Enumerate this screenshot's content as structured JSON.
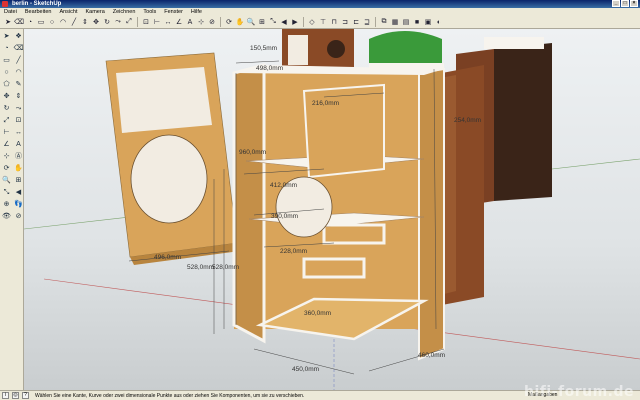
{
  "window": {
    "title": "berlin - SketchUp",
    "min": "_",
    "max": "□",
    "close": "×"
  },
  "menu": [
    "Datei",
    "Bearbeiten",
    "Ansicht",
    "Kamera",
    "Zeichnen",
    "Tools",
    "Fenster",
    "Hilfe"
  ],
  "toolbar_icons": [
    "select-icon",
    "eraser-icon",
    "paint-icon",
    "rectangle-icon",
    "circle-icon",
    "arc-icon",
    "line-icon",
    "pushpull-icon",
    "move-icon",
    "rotate-icon",
    "followme-icon",
    "scale-icon",
    "offset-icon",
    "tape-icon",
    "dimension-icon",
    "protractor-icon",
    "text-icon",
    "axes-icon",
    "section-icon",
    "orbit-icon",
    "pan-icon",
    "zoom-icon",
    "zoom-window-icon",
    "zoom-extents-icon",
    "previous-view-icon",
    "next-view-icon",
    "iso-view-icon",
    "top-view-icon",
    "front-view-icon",
    "right-view-icon",
    "back-view-icon",
    "left-view-icon",
    "xray-icon",
    "wireframe-icon",
    "hidden-line-icon",
    "shaded-icon",
    "textured-icon",
    "monochrome-icon"
  ],
  "left_tools": [
    "select",
    "component",
    "paint",
    "eraser",
    "rectangle",
    "line",
    "circle",
    "arc",
    "polygon",
    "freehand",
    "move",
    "pushpull",
    "rotate",
    "followme",
    "scale",
    "offset",
    "tape",
    "dimension",
    "protractor",
    "text",
    "axes",
    "3dtext",
    "orbit",
    "pan",
    "zoom",
    "zoom-window",
    "zoom-extents",
    "previous",
    "position-camera",
    "walk",
    "look-around",
    "section"
  ],
  "dimensions": {
    "d1": "150,5mm",
    "d2": "498,0mm",
    "d3": "216,0mm",
    "d4": "254,0mm",
    "d5": "960,0mm",
    "d6": "412,0mm",
    "d7": "390,0mm",
    "d8": "228,0mm",
    "d9": "496,0mm",
    "d10": "528,0mm",
    "d11": "528,0mm",
    "d12": "360,0mm",
    "d13": "450,0mm",
    "d14": "460,0mm"
  },
  "status": {
    "message": "Wählen Sie eine Kante, Kurve oder zwei dimensionale Punkte aus oder ziehen Sie Komponenten, um sie zu verschieben.",
    "measure_label": "Maßangaben"
  },
  "watermark": "hifi-forum.de",
  "colors": {
    "osb": "#d9a45a",
    "osb_dark": "#b8843e",
    "mahogany": "#8a4a26",
    "dark_wood": "#3a2418",
    "panel_white": "#f7f4ee"
  }
}
